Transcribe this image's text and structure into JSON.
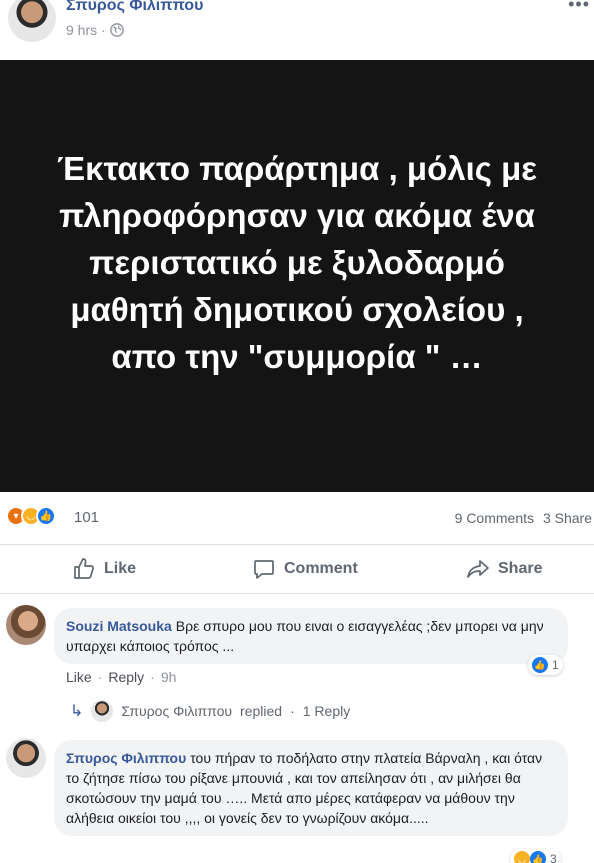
{
  "post": {
    "author": "Σπυρος Φιλιππου",
    "time": "9 hrs",
    "dot": "·",
    "privacy_icon": "globe-icon",
    "image_text_lines": [
      "Έκτακτο παράρτημα , μόλις με",
      "πληροφόρησαν για ακόμα ένα",
      "περιστατικό με ξυλοδαρμό",
      "μαθητή δημοτικού σχολείου ,",
      "απο την \"συμμορία \" …"
    ]
  },
  "stats": {
    "reaction_icons": [
      "angry-icon",
      "sad-icon",
      "like-icon"
    ],
    "reaction_count": "101",
    "comments": "9 Comments",
    "shares": "3 Share"
  },
  "actions": {
    "like": "Like",
    "comment": "Comment",
    "share": "Share"
  },
  "comments": [
    {
      "author": "Souzi Matsouka",
      "text": "Βρε σπυρο μου που ειναι ο εισαγγελέας ;δεν μπορει να μην υπαρχει κάποιος τρόπος ...",
      "like_label": "Like",
      "reply_label": "Reply",
      "dot": "·",
      "time": "9h",
      "reactions": "1"
    },
    {
      "author": "Σπυρος Φιλιππου",
      "text": "του πήραν το ποδήλατο στην πλατεία Βάρναλη , και όταν το ζήτησε πίσω του ρίξανε μπουνιά , και τον απείλησαν ότι , αν μιλήσει θα σκοτώσουν την μαμά του ….. Μετά απο μέρες κατάφεραν να μάθουν την αλήθεια οικείοι του ,,,, οι γονείς δεν το γνωρίζουν ακόμα.....",
      "reactions": "3"
    }
  ],
  "replies_summary": {
    "author": "Σπυρος Φιλιππου",
    "replied": "replied",
    "dot": "·",
    "count": "1 Reply"
  },
  "colors": {
    "link_blue": "#385898",
    "like_blue": "#1877f2",
    "image_bg": "#141414"
  }
}
